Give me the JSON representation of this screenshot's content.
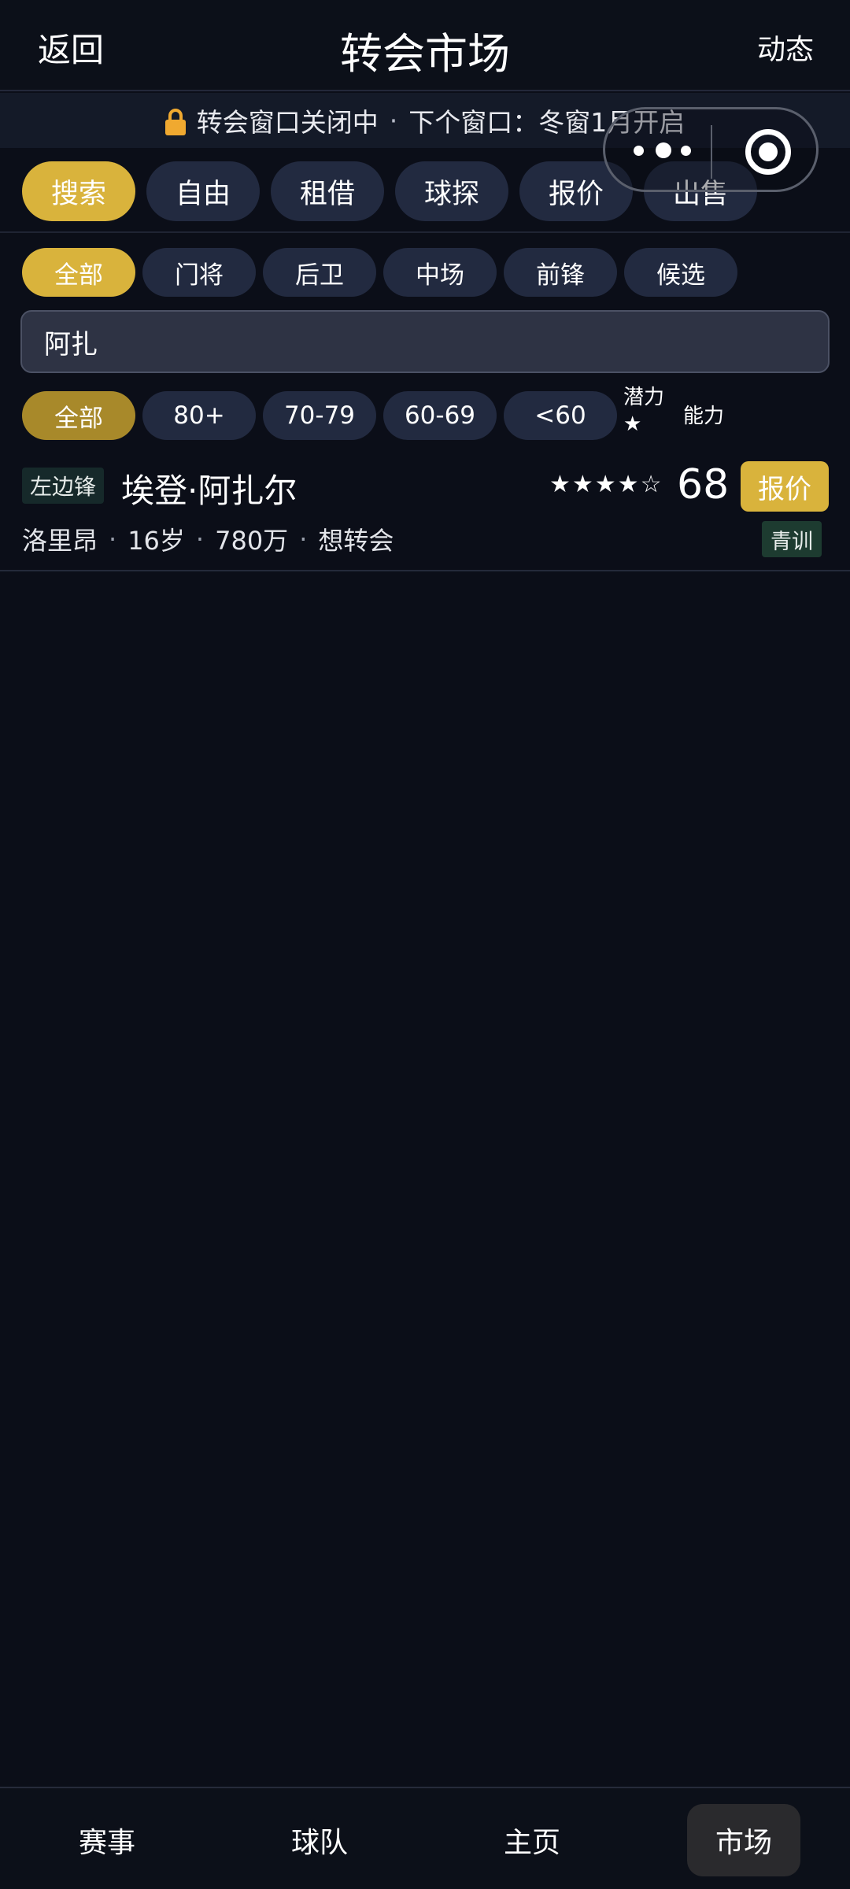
{
  "header": {
    "back_label": "返回",
    "title": "转会市场",
    "activity_label": "动态"
  },
  "notice": {
    "status": "转会窗口关闭中",
    "separator": "·",
    "next_window": "下个窗口：冬窗1月开启",
    "lock_color": "#f0a930"
  },
  "tabs": [
    {
      "label": "搜索",
      "active": true
    },
    {
      "label": "自由",
      "active": false
    },
    {
      "label": "租借",
      "active": false
    },
    {
      "label": "球探",
      "active": false
    },
    {
      "label": "报价",
      "active": false
    },
    {
      "label": "出售",
      "active": false
    }
  ],
  "position_filters": [
    {
      "label": "全部",
      "active": true
    },
    {
      "label": "门将",
      "active": false
    },
    {
      "label": "后卫",
      "active": false
    },
    {
      "label": "中场",
      "active": false
    },
    {
      "label": "前锋",
      "active": false
    },
    {
      "label": "候选",
      "active": false
    }
  ],
  "search": {
    "value": "阿扎"
  },
  "rating_filters": [
    {
      "label": "全部",
      "active": true
    },
    {
      "label": "80+",
      "active": false
    },
    {
      "label": "70-79",
      "active": false
    },
    {
      "label": "60-69",
      "active": false
    },
    {
      "label": "<60",
      "active": false
    }
  ],
  "sort": {
    "potential_label": "潜力★",
    "ability_label": "能力"
  },
  "players": [
    {
      "position": "左边锋",
      "name": "埃登·阿扎尔",
      "stars_text": "★★★★☆",
      "stars": 4,
      "rating": "68",
      "offer_label": "报价",
      "club": "洛里昂",
      "age": "16岁",
      "value": "780万",
      "status": "想转会",
      "tag": "青训"
    }
  ],
  "bottom_nav": [
    {
      "label": "赛事",
      "active": false
    },
    {
      "label": "球队",
      "active": false
    },
    {
      "label": "主页",
      "active": false
    },
    {
      "label": "市场",
      "active": true
    }
  ],
  "colors": {
    "accent": "#d9b33c",
    "background": "#0b0e18",
    "pill": "#222a40"
  }
}
